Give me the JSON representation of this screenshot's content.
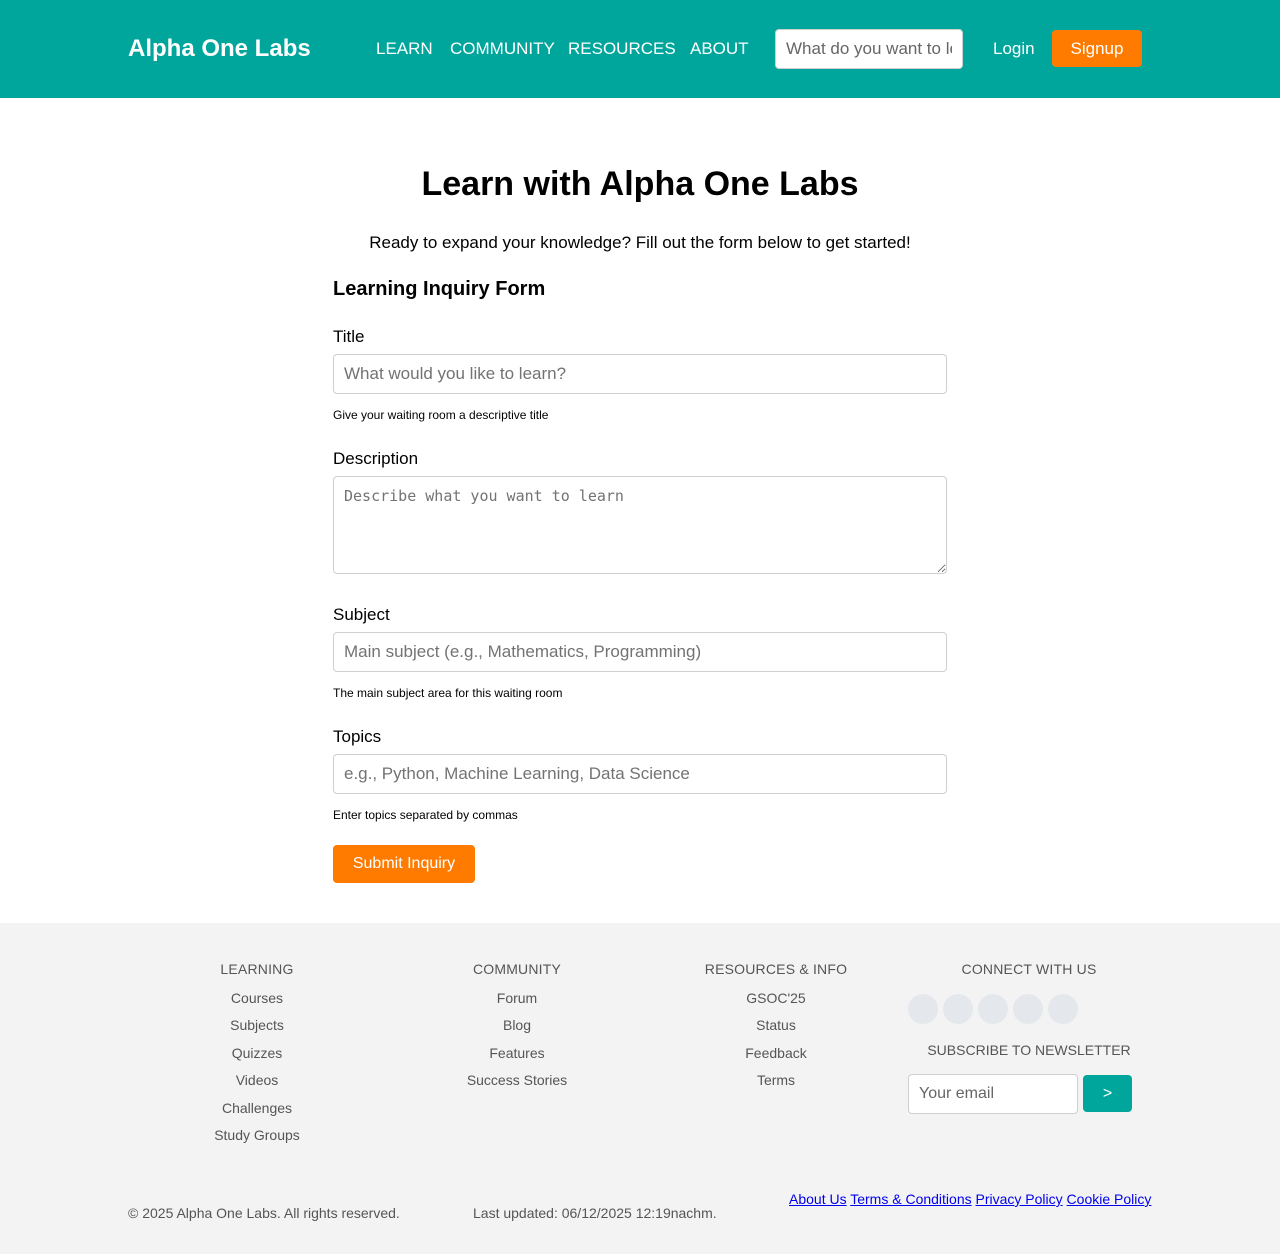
{
  "header": {
    "logo": "Alpha One Labs",
    "nav": [
      "LEARN",
      "COMMUNITY",
      "RESOURCES",
      "ABOUT"
    ],
    "search_placeholder": "What do you want to learn?",
    "login": "Login",
    "signup": "Signup"
  },
  "main": {
    "title": "Learn with Alpha One Labs",
    "intro": "Ready to expand your knowledge? Fill out the form below to get started!",
    "form_title": "Learning Inquiry Form",
    "fields": {
      "title": {
        "label": "Title",
        "placeholder": "What would you like to learn?",
        "help": "Give your waiting room a descriptive title"
      },
      "description": {
        "label": "Description",
        "placeholder": "Describe what you want to learn"
      },
      "subject": {
        "label": "Subject",
        "placeholder": "Main subject (e.g., Mathematics, Programming)",
        "help": "The main subject area for this waiting room"
      },
      "topics": {
        "label": "Topics",
        "placeholder": "e.g., Python, Machine Learning, Data Science",
        "help": "Enter topics separated by commas"
      }
    },
    "submit": "Submit Inquiry"
  },
  "footer": {
    "columns": [
      {
        "heading": "LEARNING",
        "links": [
          "Courses",
          "Subjects",
          "Quizzes",
          "Videos",
          "Challenges",
          "Study Groups"
        ]
      },
      {
        "heading": "COMMUNITY",
        "links": [
          "Forum",
          "Blog",
          "Features",
          "Success Stories"
        ]
      },
      {
        "heading": "RESOURCES & INFO",
        "links": [
          "GSOC'25",
          "Status",
          "Feedback",
          "Terms"
        ]
      }
    ],
    "connect_heading": "CONNECT WITH US",
    "newsletter_heading": "SUBSCRIBE TO NEWSLETTER",
    "email_placeholder": "Your email",
    "subscribe_button": ">",
    "copyright": "© 2025 Alpha One Labs. All rights reserved.",
    "last_updated": "Last updated: 06/12/2025 12:19nachm.",
    "legal_links": [
      "About Us",
      "Terms & Conditions",
      "Privacy Policy",
      "Cookie Policy"
    ]
  },
  "colors": {
    "brand_teal": "#00a69c",
    "accent_orange": "#ff7b00",
    "footer_bg": "#f3f3f3"
  }
}
